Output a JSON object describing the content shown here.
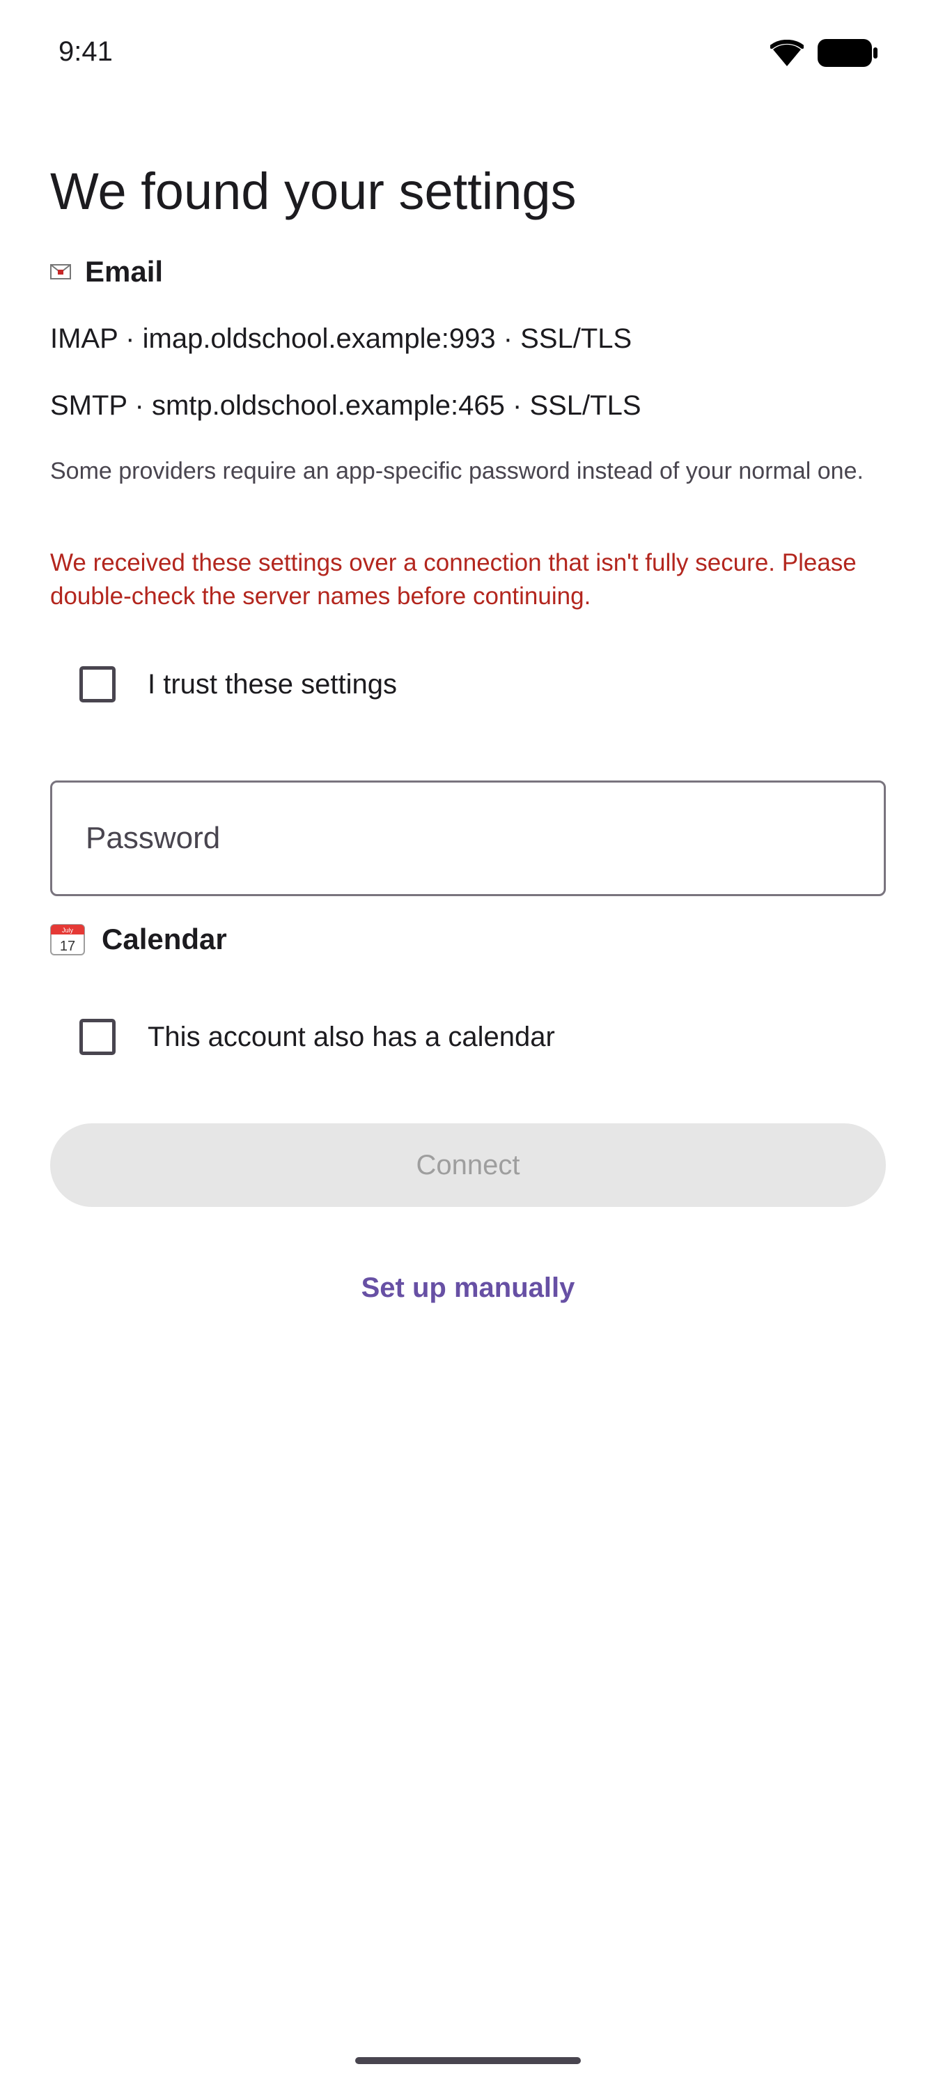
{
  "status_bar": {
    "time": "9:41",
    "icons": [
      "wifi-icon",
      "battery-icon"
    ]
  },
  "title": "We found your settings",
  "email_section": {
    "icon": "envelope-icon",
    "label": "Email",
    "imap": "IMAP · imap.oldschool.example:993 · SSL/TLS",
    "smtp": "SMTP · smtp.oldschool.example:465 · SSL/TLS",
    "note": "Some providers require an app-specific password instead of your normal one.",
    "warning": "We received these settings over a connection that isn't fully secure. Please double-check the server names before continuing.",
    "trust_checkbox": {
      "label": "I trust these settings",
      "checked": false
    },
    "password": {
      "placeholder": "Password",
      "value": ""
    }
  },
  "calendar_section": {
    "icon": "calendar-icon",
    "icon_month": "July",
    "icon_day": "17",
    "label": "Calendar",
    "calendar_checkbox": {
      "label": "This account also has a calendar",
      "checked": false
    }
  },
  "actions": {
    "connect_label": "Connect",
    "connect_enabled": false,
    "manual_label": "Set up manually"
  },
  "colors": {
    "warning": "#b3261e",
    "link": "#6750a4",
    "disabled_button_bg": "#e6e6e6",
    "disabled_button_text": "#9e9e9e"
  }
}
